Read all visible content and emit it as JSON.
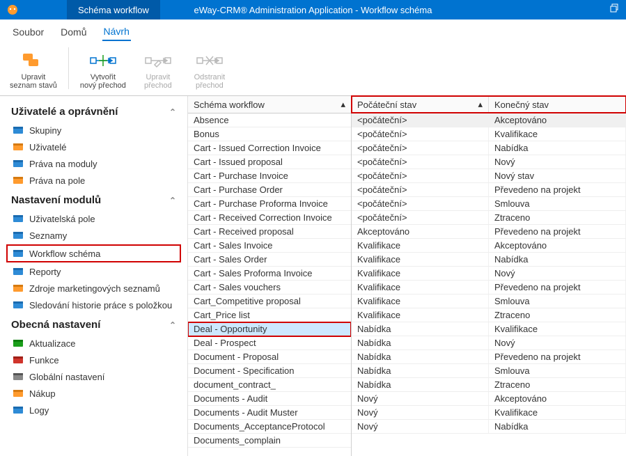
{
  "titlebar": {
    "tab": "Schéma workflow",
    "title": "eWay-CRM® Administration Application - Workflow schéma"
  },
  "ribbon_tabs": {
    "file": "Soubor",
    "home": "Domů",
    "design": "Návrh"
  },
  "ribbon": {
    "editStates1": "Upravit",
    "editStates2": "seznam stavů",
    "newTrans1": "Vytvořit",
    "newTrans2": "nový přechod",
    "editTrans1": "Upravit",
    "editTrans2": "přechod",
    "delTrans1": "Odstranit",
    "delTrans2": "přechod"
  },
  "sidebar": {
    "sec1": "Uživatelé a oprávnění",
    "items1": [
      "Skupiny",
      "Uživatelé",
      "Práva na moduly",
      "Práva na pole"
    ],
    "sec2": "Nastavení modulů",
    "items2": [
      "Uživatelská pole",
      "Seznamy",
      "Workflow schéma",
      "Reporty",
      "Zdroje marketingových seznamů",
      "Sledování historie práce s položkou"
    ],
    "sec3": "Obecná nastavení",
    "items3": [
      "Aktualizace",
      "Funkce",
      "Globální nastavení",
      "Nákup",
      "Logy"
    ]
  },
  "mid": {
    "header": "Schéma workflow",
    "rows": [
      "Absence",
      "Bonus",
      "Cart - Issued Correction Invoice",
      "Cart - Issued proposal",
      "Cart - Purchase Invoice",
      "Cart - Purchase Order",
      "Cart - Purchase Proforma Invoice",
      "Cart - Received Correction Invoice",
      "Cart - Received proposal",
      "Cart - Sales Invoice",
      "Cart - Sales Order",
      "Cart - Sales Proforma Invoice",
      "Cart - Sales vouchers",
      "Cart_Competitive proposal",
      "Cart_Price list",
      "Deal - Opportunity",
      "Deal - Prospect",
      "Document - Proposal",
      "Document - Specification",
      "document_contract_",
      "Documents - Audit",
      "Documents - Audit Muster",
      "Documents_AcceptanceProtocol",
      "Documents_complain"
    ],
    "selectedIndex": 15
  },
  "right": {
    "header1": "Počáteční stav",
    "header2": "Konečný stav",
    "rows": [
      {
        "a": "<počáteční>",
        "b": "Akceptováno"
      },
      {
        "a": "<počáteční>",
        "b": "Kvalifikace"
      },
      {
        "a": "<počáteční>",
        "b": "Nabídka"
      },
      {
        "a": "<počáteční>",
        "b": "Nový"
      },
      {
        "a": "<počáteční>",
        "b": "Nový stav"
      },
      {
        "a": "<počáteční>",
        "b": "Převedeno na projekt"
      },
      {
        "a": "<počáteční>",
        "b": "Smlouva"
      },
      {
        "a": "<počáteční>",
        "b": "Ztraceno"
      },
      {
        "a": "Akceptováno",
        "b": "Převedeno na projekt"
      },
      {
        "a": "Kvalifikace",
        "b": "Akceptováno"
      },
      {
        "a": "Kvalifikace",
        "b": "Nabídka"
      },
      {
        "a": "Kvalifikace",
        "b": "Nový"
      },
      {
        "a": "Kvalifikace",
        "b": "Převedeno na projekt"
      },
      {
        "a": "Kvalifikace",
        "b": "Smlouva"
      },
      {
        "a": "Kvalifikace",
        "b": "Ztraceno"
      },
      {
        "a": "Nabídka",
        "b": "Kvalifikace"
      },
      {
        "a": "Nabídka",
        "b": "Nový"
      },
      {
        "a": "Nabídka",
        "b": "Převedeno na projekt"
      },
      {
        "a": "Nabídka",
        "b": "Smlouva"
      },
      {
        "a": "Nabídka",
        "b": "Ztraceno"
      },
      {
        "a": "Nový",
        "b": "Akceptováno"
      },
      {
        "a": "Nový",
        "b": "Kvalifikace"
      },
      {
        "a": "Nový",
        "b": "Nabídka"
      }
    ],
    "selectedIndex": 0
  }
}
